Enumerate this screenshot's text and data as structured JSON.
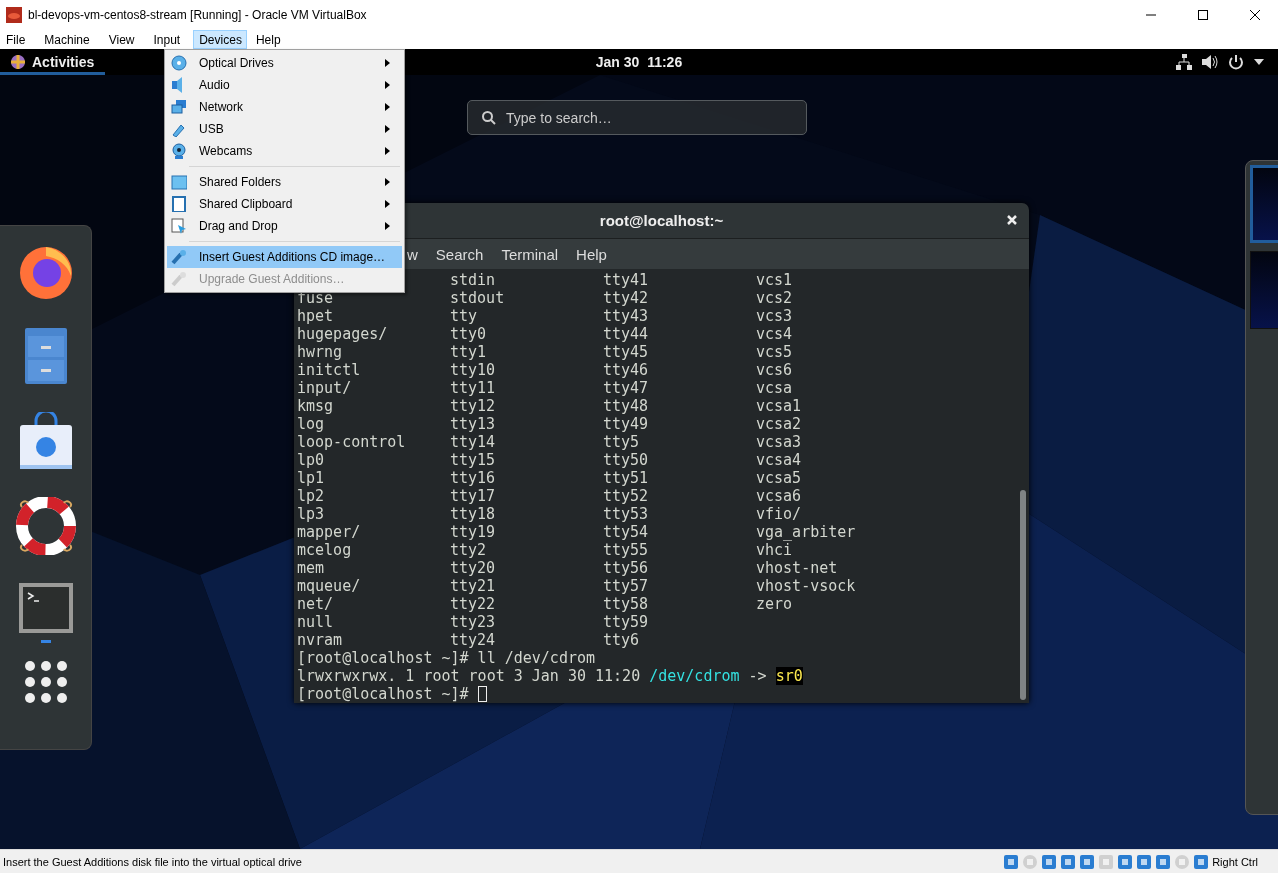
{
  "window": {
    "title": "bl-devops-vm-centos8-stream [Running] - Oracle VM VirtualBox",
    "menubar": [
      {
        "label": "File",
        "selected": false
      },
      {
        "label": "Machine",
        "selected": false
      },
      {
        "label": "View",
        "selected": false
      },
      {
        "label": "Input",
        "selected": false
      },
      {
        "label": "Devices",
        "selected": true
      },
      {
        "label": "Help",
        "selected": false
      }
    ]
  },
  "guest": {
    "top_bar": {
      "activities": "Activities",
      "clock": "Jan 30  11:26"
    },
    "search": {
      "placeholder": "Type to search…"
    },
    "dock": {
      "apps": [
        {
          "running": false
        },
        {
          "running": false
        },
        {
          "running": false
        },
        {
          "running": false
        },
        {
          "running": true
        }
      ]
    },
    "workspaces": [
      {
        "selected": true
      },
      {
        "selected": false
      }
    ],
    "terminal": {
      "title": "root@localhost:~",
      "menu": [
        "w",
        "Search",
        "Terminal",
        "Help"
      ],
      "rows": [
        {
          "column_2": "stdin",
          "column_3": "tty41",
          "column_4": "vcs1"
        },
        {
          "column_1": "fuse",
          "column_2": "stdout",
          "column_3": "tty42",
          "column_4": "vcs2"
        },
        {
          "column_1": "hpet",
          "column_2": "tty",
          "column_3": "tty43",
          "column_4": "vcs3"
        },
        {
          "column_1": "hugepages/",
          "column_2": "tty0",
          "column_3": "tty44",
          "column_4": "vcs4"
        },
        {
          "column_1": "hwrng",
          "column_2": "tty1",
          "column_3": "tty45",
          "column_4": "vcs5"
        },
        {
          "column_1": "initctl",
          "column_2": "tty10",
          "column_3": "tty46",
          "column_4": "vcs6"
        },
        {
          "column_1": "input/",
          "column_2": "tty11",
          "column_3": "tty47",
          "column_4": "vcsa"
        },
        {
          "column_1": "kmsg",
          "column_2": "tty12",
          "column_3": "tty48",
          "column_4": "vcsa1"
        },
        {
          "column_1": "log",
          "column_2": "tty13",
          "column_3": "tty49",
          "column_4": "vcsa2"
        },
        {
          "column_1": "loop-control",
          "column_2": "tty14",
          "column_3": "tty5",
          "column_4": "vcsa3"
        },
        {
          "column_1": "lp0",
          "column_2": "tty15",
          "column_3": "tty50",
          "column_4": "vcsa4"
        },
        {
          "column_1": "lp1",
          "column_2": "tty16",
          "column_3": "tty51",
          "column_4": "vcsa5"
        },
        {
          "column_1": "lp2",
          "column_2": "tty17",
          "column_3": "tty52",
          "column_4": "vcsa6"
        },
        {
          "column_1": "lp3",
          "column_2": "tty18",
          "column_3": "tty53",
          "column_4": "vfio/"
        },
        {
          "column_1": "mapper/",
          "column_2": "tty19",
          "column_3": "tty54",
          "column_4": "vga_arbiter"
        },
        {
          "column_1": "mcelog",
          "column_2": "tty2",
          "column_3": "tty55",
          "column_4": "vhci"
        },
        {
          "column_1": "mem",
          "column_2": "tty20",
          "column_3": "tty56",
          "column_4": "vhost-net"
        },
        {
          "column_1": "mqueue/",
          "column_2": "tty21",
          "column_3": "tty57",
          "column_4": "vhost-vsock"
        },
        {
          "column_1": "net/",
          "column_2": "tty22",
          "column_3": "tty58",
          "column_4": "zero"
        },
        {
          "column_1": "null",
          "column_2": "tty23",
          "column_3": "tty59"
        },
        {
          "column_1": "nvram",
          "column_2": "tty24",
          "column_3": "tty6"
        }
      ],
      "lines": [
        {
          "cursor": false,
          "segments": [
            {
              "kind": "plain",
              "text": "[root@localhost ~]# ll /dev/cdrom"
            }
          ]
        },
        {
          "cursor": false,
          "segments": [
            {
              "kind": "plain",
              "text": "lrwxrwxrwx. 1 root root 3 Jan 30 11:20 "
            },
            {
              "kind": "path",
              "text": "/dev/cdrom"
            },
            {
              "kind": "plain",
              "text": " -> "
            },
            {
              "kind": "highlight",
              "text": "sr0"
            }
          ]
        },
        {
          "cursor": true,
          "segments": [
            {
              "kind": "plain",
              "text": "[root@localhost ~]# "
            }
          ]
        }
      ]
    }
  },
  "devices_menu": {
    "groups": [
      [
        {
          "label": "Optical Drives",
          "submenu": true,
          "selected": false,
          "disabled": false
        },
        {
          "label": "Audio",
          "submenu": true,
          "selected": false,
          "disabled": false
        },
        {
          "label": "Network",
          "submenu": true,
          "selected": false,
          "disabled": false
        },
        {
          "label": "USB",
          "submenu": true,
          "selected": false,
          "disabled": false
        },
        {
          "label": "Webcams",
          "submenu": true,
          "selected": false,
          "disabled": false
        }
      ],
      [
        {
          "label": "Shared Folders",
          "submenu": true,
          "selected": false,
          "disabled": false
        },
        {
          "label": "Shared Clipboard",
          "submenu": true,
          "selected": false,
          "disabled": false
        },
        {
          "label": "Drag and Drop",
          "submenu": true,
          "selected": false,
          "disabled": false
        }
      ],
      [
        {
          "label": "Insert Guest Additions CD image…",
          "submenu": false,
          "selected": true,
          "disabled": false
        },
        {
          "label": "Upgrade Guest Additions…",
          "submenu": false,
          "selected": false,
          "disabled": true
        }
      ]
    ]
  },
  "status_bar": {
    "message": "Insert the Guest Additions disk file into the virtual optical drive",
    "host_key": "Right Ctrl"
  }
}
